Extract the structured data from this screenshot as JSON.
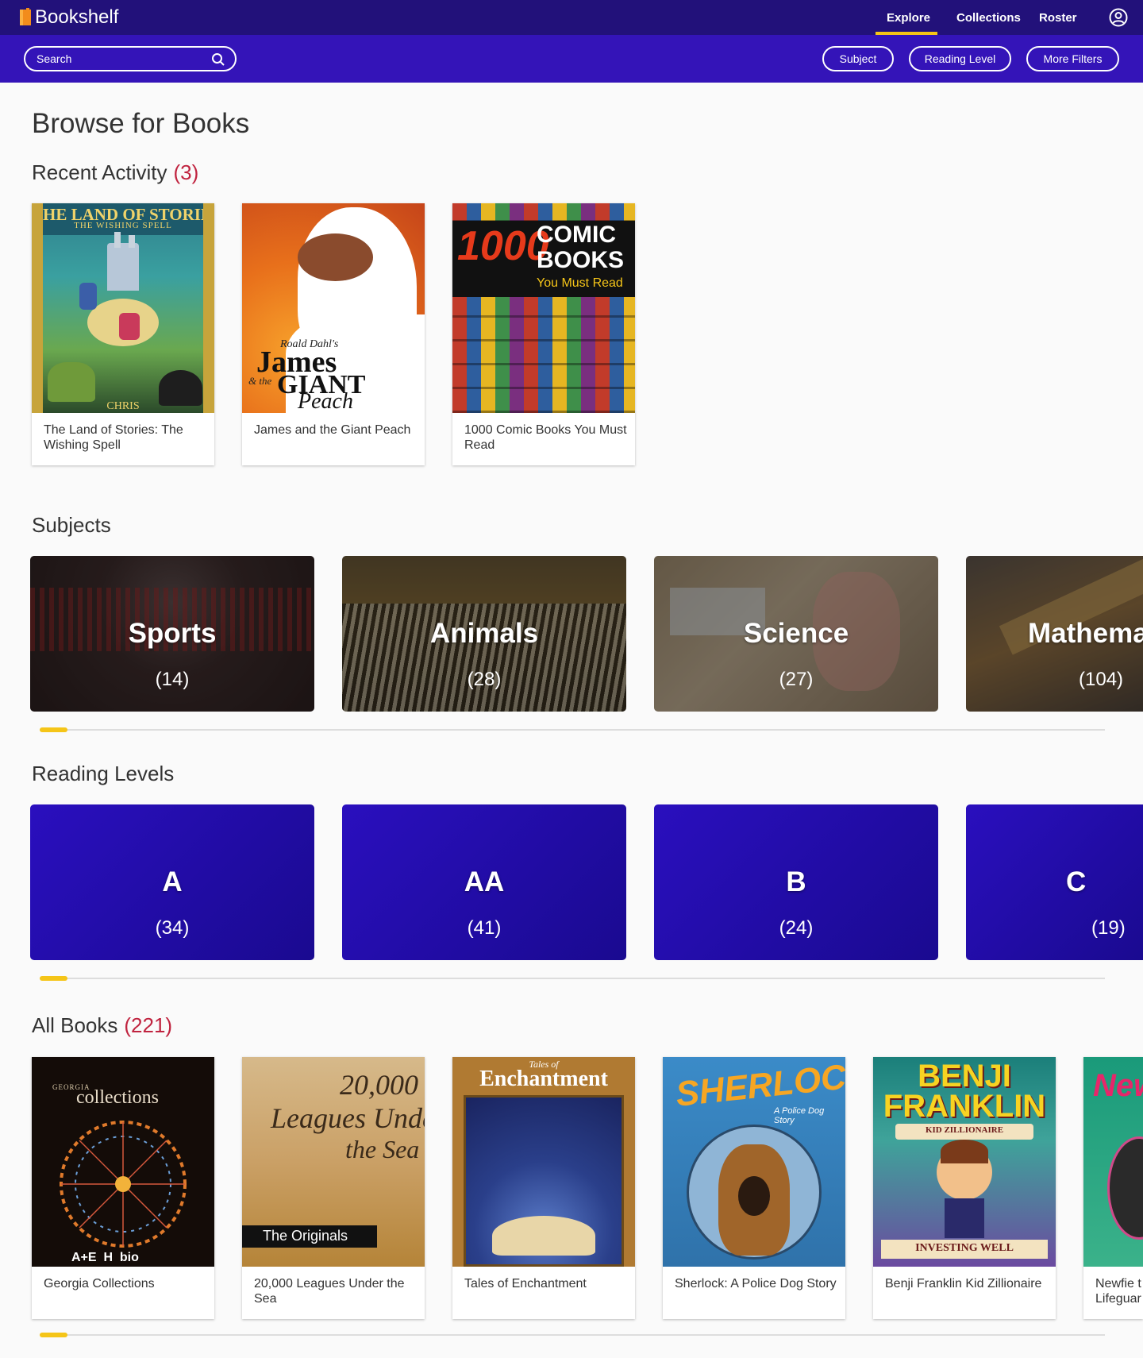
{
  "app": {
    "name": "Bookshelf"
  },
  "nav": {
    "explore": "Explore",
    "collections": "Collections",
    "roster": "Roster"
  },
  "filters": {
    "search_placeholder": "Search",
    "subject": "Subject",
    "reading_level": "Reading Level",
    "more": "More Filters"
  },
  "page": {
    "title": "Browse for Books"
  },
  "recent": {
    "title": "Recent Activity",
    "count": "(3)",
    "books": [
      {
        "title": "The Land of Stories: The Wishing Spell",
        "cover_text": "THE LAND OF STORIES",
        "cover_sub": "THE WISHING SPELL",
        "cover_author": "CHRIS"
      },
      {
        "title": "James and the Giant Peach",
        "cover_text": "James",
        "cover_sub": "GIANT",
        "cover_author": "Roald Dahl's",
        "cover_extra": "Peach",
        "cover_and": "& the"
      },
      {
        "title": "1000 Comic Books You Must Read",
        "cover_text": "1000",
        "cover_sub": "COMIC BOOKS",
        "cover_author": "You Must Read"
      }
    ]
  },
  "subjects": {
    "title": "Subjects",
    "items": [
      {
        "name": "Sports",
        "count": "(14)"
      },
      {
        "name": "Animals",
        "count": "(28)"
      },
      {
        "name": "Science",
        "count": "(27)"
      },
      {
        "name": "Mathema",
        "count": "(104)"
      }
    ]
  },
  "levels": {
    "title": "Reading Levels",
    "items": [
      {
        "name": "A",
        "count": "(34)"
      },
      {
        "name": "AA",
        "count": "(41)"
      },
      {
        "name": "B",
        "count": "(24)"
      },
      {
        "name": "C",
        "count": "(19)"
      }
    ]
  },
  "all": {
    "title": "All Books",
    "count": "(221)",
    "books": [
      {
        "title": "Georgia Collections",
        "cover_text": "collections",
        "cover_sub": "GEORGIA",
        "cover_author": "A+E  H  bio"
      },
      {
        "title": "20,000 Leagues Under the Sea",
        "cover_text": "20,000",
        "cover_sub": "Leagues Under",
        "cover_author": "The Originals",
        "cover_extra": "the Sea"
      },
      {
        "title": "Tales of Enchantment",
        "cover_text": "Enchantment",
        "cover_sub": "Tales of"
      },
      {
        "title": "Sherlock: A Police Dog Story",
        "cover_text": "SHERLOCK",
        "cover_sub": "A Police Dog Story"
      },
      {
        "title": "Benji Franklin Kid Zillionaire",
        "cover_text": "BENJI",
        "cover_sub": "FRANKLIN",
        "cover_author": "KID ZILLIONAIRE",
        "cover_extra": "INVESTING WELL"
      },
      {
        "title": "Newfie t Lifeguar",
        "cover_text": "New"
      }
    ]
  },
  "colors": {
    "topbar": "#22117a",
    "filterbar": "#3414b8",
    "accent": "#f5c518",
    "count": "#c0233f"
  },
  "icons": {
    "logo": "book-icon",
    "search": "search-icon",
    "user": "user-circle-icon"
  }
}
